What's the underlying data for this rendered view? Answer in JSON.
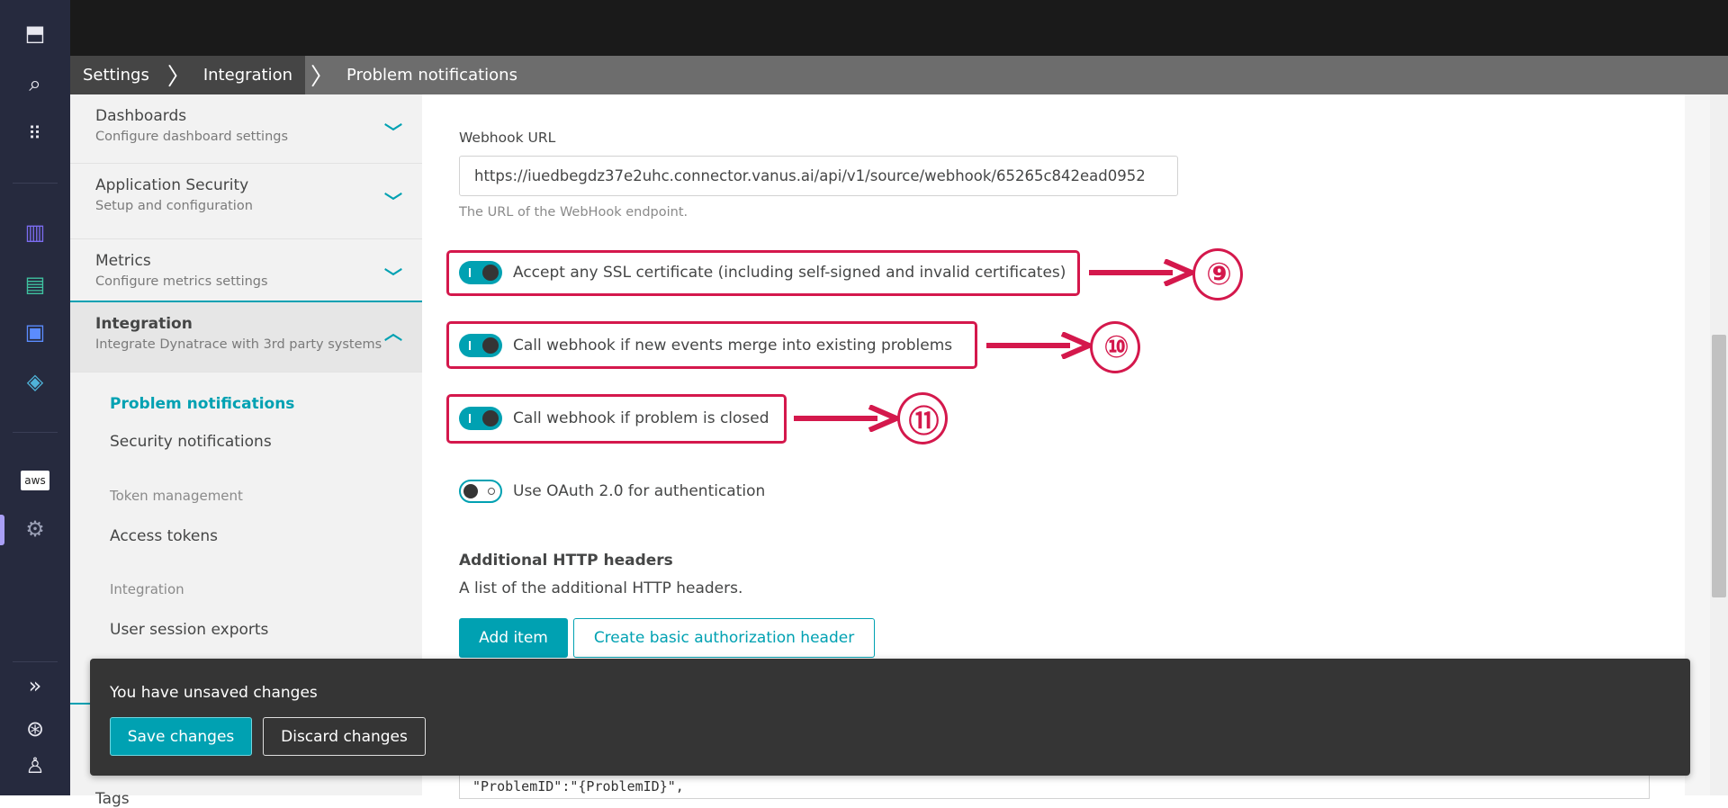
{
  "breadcrumb": [
    "Settings",
    "Integration",
    "Problem notifications"
  ],
  "sidebar": {
    "sections": [
      {
        "title": "Dashboards",
        "subtitle": "Configure dashboard settings"
      },
      {
        "title": "Application Security",
        "subtitle": "Setup and configuration"
      },
      {
        "title": "Metrics",
        "subtitle": "Configure metrics settings"
      },
      {
        "title": "Integration",
        "subtitle": "Integrate Dynatrace with 3rd party systems"
      }
    ],
    "active": "Problem notifications",
    "security": "Security notifications",
    "token_header": "Token management",
    "access_tokens": "Access tokens",
    "integration_header": "Integration",
    "user_session": "User session exports",
    "tags": "Tags"
  },
  "form": {
    "webhook_label": "Webhook URL",
    "webhook_value": "https://iuedbegdz37e2uhc.connector.vanus.ai/api/v1/source/webhook/65265c842ead0952",
    "webhook_help": "The URL of the WebHook endpoint.",
    "toggles": [
      {
        "label": "Accept any SSL certificate (including self-signed and invalid certificates)",
        "on": true,
        "annotation": "⑨"
      },
      {
        "label": "Call webhook if new events merge into existing problems",
        "on": true,
        "annotation": "⑩"
      },
      {
        "label": "Call webhook if problem is closed",
        "on": true,
        "annotation": "⑪"
      },
      {
        "label": "Use OAuth 2.0 for authentication",
        "on": false
      }
    ],
    "headers_title": "Additional HTTP headers",
    "headers_desc": "A list of the additional HTTP headers.",
    "add_item": "Add item",
    "create_basic": "Create basic authorization header",
    "code_line": "\"ProblemID\":\"{ProblemID}\","
  },
  "toast": {
    "message": "You have unsaved changes",
    "save": "Save changes",
    "discard": "Discard changes"
  },
  "colors": {
    "accent": "#00a1b2",
    "annotation": "#d4184c"
  }
}
